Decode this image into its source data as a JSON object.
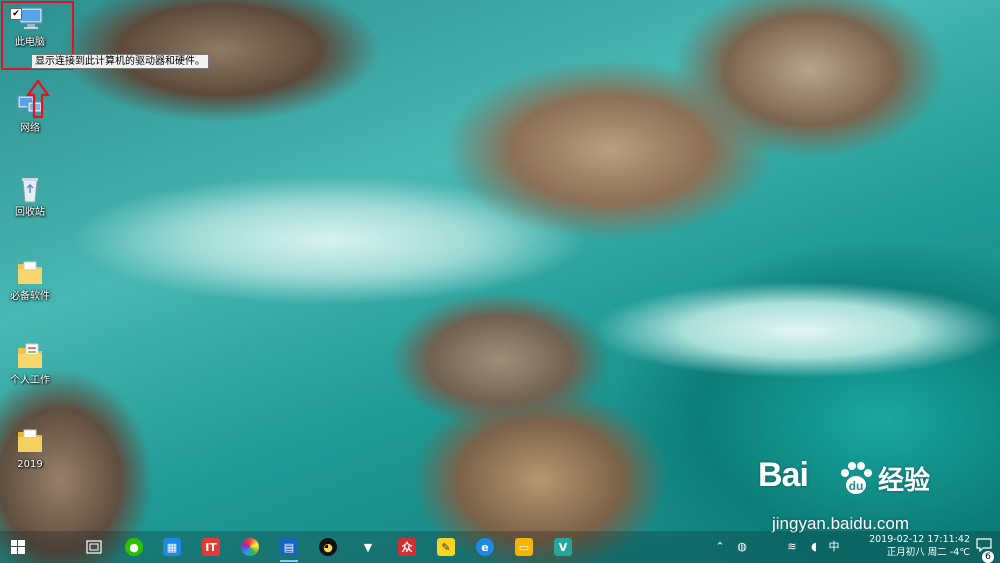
{
  "desktop": {
    "icons": [
      {
        "label": "此电脑",
        "icon": "computer-icon"
      },
      {
        "label": "网络",
        "icon": "network-icon"
      },
      {
        "label": "回收站",
        "icon": "recycle-bin-icon"
      },
      {
        "label": "必备软件",
        "icon": "folder-icon"
      },
      {
        "label": "个人工作",
        "icon": "folder-icon"
      },
      {
        "label": "2019",
        "icon": "folder-icon"
      }
    ],
    "tooltip": "显示连接到此计算机的驱动器和硬件。",
    "selected_check": "✔"
  },
  "watermark": {
    "brand": "Bai",
    "brand_suffix": "经验",
    "url": "jingyan.baidu.com"
  },
  "taskbar": {
    "apps": [
      {
        "name": "start",
        "icon": "windows-start-icon",
        "color": "#ffffff"
      },
      {
        "name": "taskview",
        "icon": "task-view-icon",
        "color": "#ffffff"
      },
      {
        "name": "wechat",
        "icon": "wechat-icon",
        "color": "#2dc100"
      },
      {
        "name": "app-blue",
        "icon": "blue-app-icon",
        "color": "#1e88e5"
      },
      {
        "name": "app-red",
        "icon": "red-app-icon",
        "color": "#e53935"
      },
      {
        "name": "app-color",
        "icon": "color-wheel-icon",
        "color": "#ff9800"
      },
      {
        "name": "app-store",
        "icon": "store-icon",
        "color": "#1565c0"
      },
      {
        "name": "qq",
        "icon": "qq-penguin-icon",
        "color": "#111111"
      },
      {
        "name": "fox",
        "icon": "fox-icon",
        "color": "#ffffff"
      },
      {
        "name": "app-red2",
        "icon": "red-doc-icon",
        "color": "#d32f2f"
      },
      {
        "name": "notes",
        "icon": "notes-icon",
        "color": "#f9d423"
      },
      {
        "name": "ie",
        "icon": "internet-explorer-icon",
        "color": "#1e88e5"
      },
      {
        "name": "explorer",
        "icon": "file-explorer-icon",
        "color": "#f4b400"
      },
      {
        "name": "app-teal",
        "icon": "vpn-icon",
        "color": "#26a69a"
      }
    ],
    "tray": {
      "ime": "中",
      "date": "2019-02-12",
      "time": "17:11:42",
      "lunar": "正月初八",
      "weekday": "周二",
      "temp": "-4℃",
      "notifications": "6"
    }
  },
  "colors": {
    "highlight": "#e8101e",
    "accent": "#8fc6f5"
  }
}
